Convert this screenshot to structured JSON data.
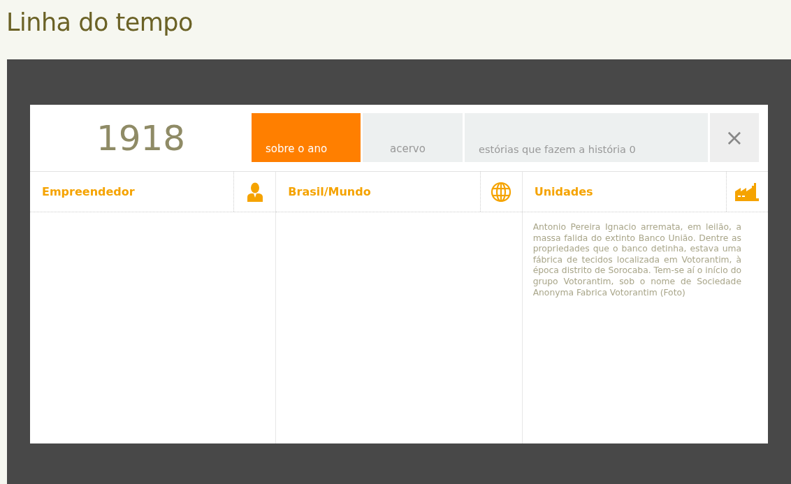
{
  "page": {
    "title": "Linha do tempo"
  },
  "modal": {
    "year": "1918",
    "tabs": [
      {
        "label": "sobre o ano",
        "selected": true
      },
      {
        "label": "acervo",
        "selected": false
      },
      {
        "label": "estórias que fazem a história 0",
        "selected": false
      }
    ],
    "close": {
      "label": "×"
    },
    "columns": [
      {
        "title": "Empreendedor"
      },
      {
        "title": "Brasil/Mundo"
      },
      {
        "title": "Unidades",
        "text": "Antonio Pereira Ignacio arremata, em leilão, a massa falida do extinto Banco União. Dentre as propriedades que o banco detinha, estava uma fábrica de tecidos localizada em Votorantim, à época distrito de Sorocaba. Tem-se aí o início do grupo Votorantim, sob o nome de Sociedade Anonyma Fabrica Votorantim (Foto)"
      }
    ]
  }
}
